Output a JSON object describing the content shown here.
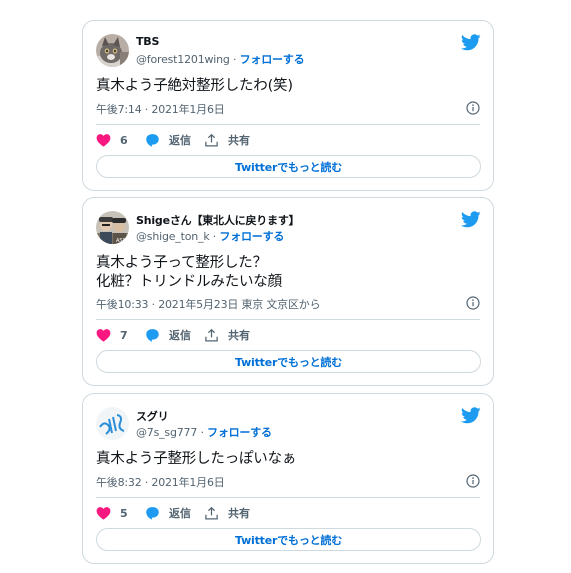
{
  "tweets": [
    {
      "display_name": "TBS",
      "handle": "@forest1201wing",
      "separator": "·",
      "follow_label": "フォローする",
      "text": "真木よう子絶対整形したわ(笑)",
      "timestamp": "午後7:14 · 2021年1月6日",
      "like_count": "6",
      "reply_label": "返信",
      "share_label": "共有",
      "read_more_label": "Twitterでもっと読む",
      "avatar_icon": "cat-photo-avatar"
    },
    {
      "display_name": "Shigeさん【東北人に戻ります】",
      "handle": "@shige_ton_k",
      "separator": "·",
      "follow_label": "フォローする",
      "text": "真木よう子って整形した？\n化粧？トリンドルみたいな顔",
      "timestamp": "午後10:33 · 2021年5月23日 東京 文京区から",
      "like_count": "7",
      "reply_label": "返信",
      "share_label": "共有",
      "read_more_label": "Twitterでもっと読む",
      "avatar_icon": "two-people-photo-avatar"
    },
    {
      "display_name": "スグリ",
      "handle": "@7s_sg777",
      "separator": "·",
      "follow_label": "フォローする",
      "text": "真木よう子整形したっぽいなぁ",
      "timestamp": "午後8:32 · 2021年1月6日",
      "like_count": "5",
      "reply_label": "返信",
      "share_label": "共有",
      "read_more_label": "Twitterでもっと読む",
      "avatar_icon": "handwritten-logo-avatar"
    }
  ],
  "colors": {
    "twitter_blue": "#1d9bf0",
    "link_blue": "#006fd6",
    "like_pink": "#f91880",
    "border": "#cfd9de",
    "muted_text": "#536471"
  },
  "icons": {
    "brand": "twitter-bird-icon",
    "like": "heart-icon",
    "reply": "speech-bubble-icon",
    "share": "share-upload-icon",
    "info": "info-circle-icon"
  }
}
